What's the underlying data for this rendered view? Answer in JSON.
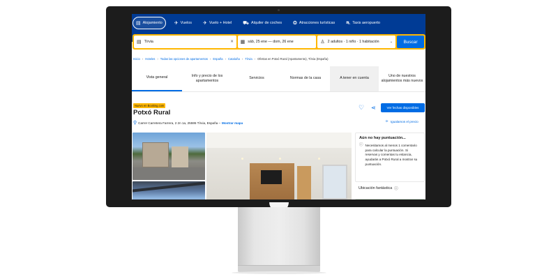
{
  "nav": {
    "items": [
      {
        "label": "Alojamiento",
        "icon": "bed-icon",
        "active": true
      },
      {
        "label": "Vuelos",
        "icon": "plane-icon"
      },
      {
        "label": "Vuelo + Hotel",
        "icon": "plane-hotel-icon"
      },
      {
        "label": "Alquiler de coches",
        "icon": "car-icon"
      },
      {
        "label": "Atracciones turísticas",
        "icon": "attractions-icon"
      },
      {
        "label": "Taxis aeropuerto",
        "icon": "taxi-icon"
      }
    ]
  },
  "search": {
    "destination": "Tírvia",
    "clear_glyph": "✕",
    "dates": "sáb, 25 ene  —  dom, 26 ene",
    "guests": "2 adultos · 1 niño · 1 habitación",
    "button_label": "Buscar"
  },
  "breadcrumb": [
    "Inicio",
    "Hoteles",
    "Todas las opciones de apartamentos",
    "España",
    "Cataluña",
    "Tírvia",
    "Ofertas en Potxó Rural (Apartamento), Tírvia (España)"
  ],
  "tabs": [
    "Vista general",
    "Info y precio de los apartamentos",
    "Servicios",
    "Normas de la casa",
    "A tener en cuenta",
    "Uno de nuestros alojamientos más nuevos"
  ],
  "property": {
    "badge": "Nuevo en Booking.com",
    "name": "Potxó Rural",
    "address": "Carrer Carretera Farrera, 2 2n 1a, 25595 Tírvia, España –",
    "map_link": "Mostrar mapa",
    "cta_label": "Ver fechas disponibles",
    "price_match": "Igualamos el precio"
  },
  "review": {
    "title": "Aún no hay puntuación...",
    "text": "Necesitamos al menos 1 comentario para calcular la puntuación. Si reservas y comentas tu estancia, ayudarás a Potxó Rural a mostrar su puntuación.",
    "location_label": "Ubicación fantástica"
  },
  "colors": {
    "header_blue": "#003b95",
    "accent_blue": "#006ce4",
    "search_yellow": "#ffb700"
  }
}
